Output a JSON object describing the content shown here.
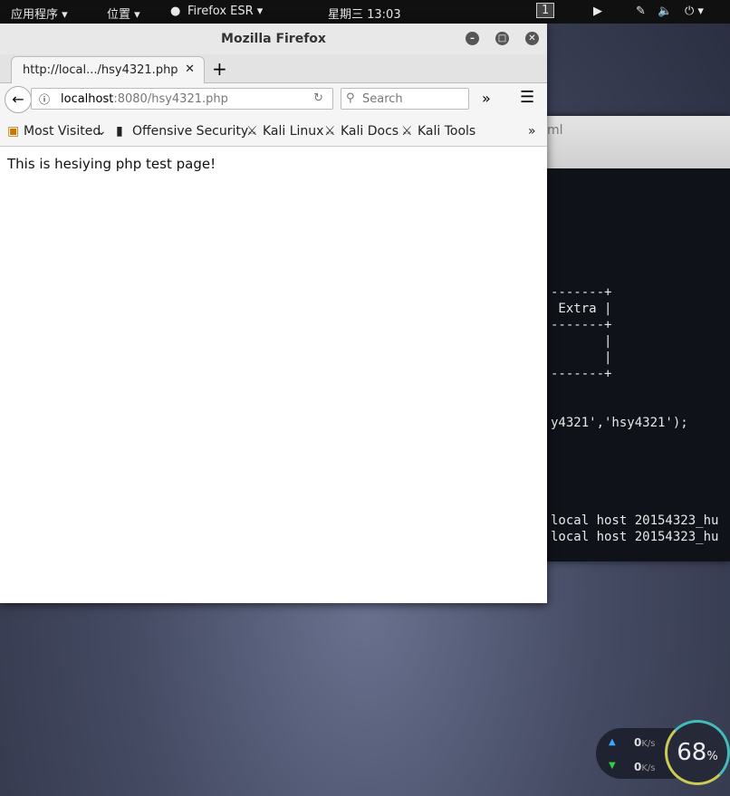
{
  "topbar": {
    "apps": "应用程序 ▾",
    "places": "位置 ▾",
    "active_app": "Firefox ESR ▾",
    "clock": "星期三 13:03",
    "workspace": "1"
  },
  "terminal": {
    "title_fragment": "ml",
    "lines": [
      "-------+",
      " Extra |",
      "-------+",
      "       |",
      "       |",
      "-------+",
      "",
      "",
      "y4321','hsy4321');",
      "",
      "",
      "",
      "",
      "local host 20154323_hu",
      "local host 20154323_hu"
    ]
  },
  "firefox": {
    "window_title": "Mozilla Firefox",
    "tab_label": "http://local.../hsy4321.php",
    "url_host": "localhost",
    "url_rest": ":8080/hsy4321.php",
    "search_placeholder": "Search",
    "bookmarks": [
      "Most Visited",
      "Offensive Security",
      "Kali Linux",
      "Kali Docs",
      "Kali Tools"
    ],
    "page_text": "This is hesiying php test page!"
  },
  "netwidget": {
    "upload": "0",
    "download": "0",
    "unit": "K/s",
    "cpu_percent": "68",
    "percent_sign": "%"
  }
}
